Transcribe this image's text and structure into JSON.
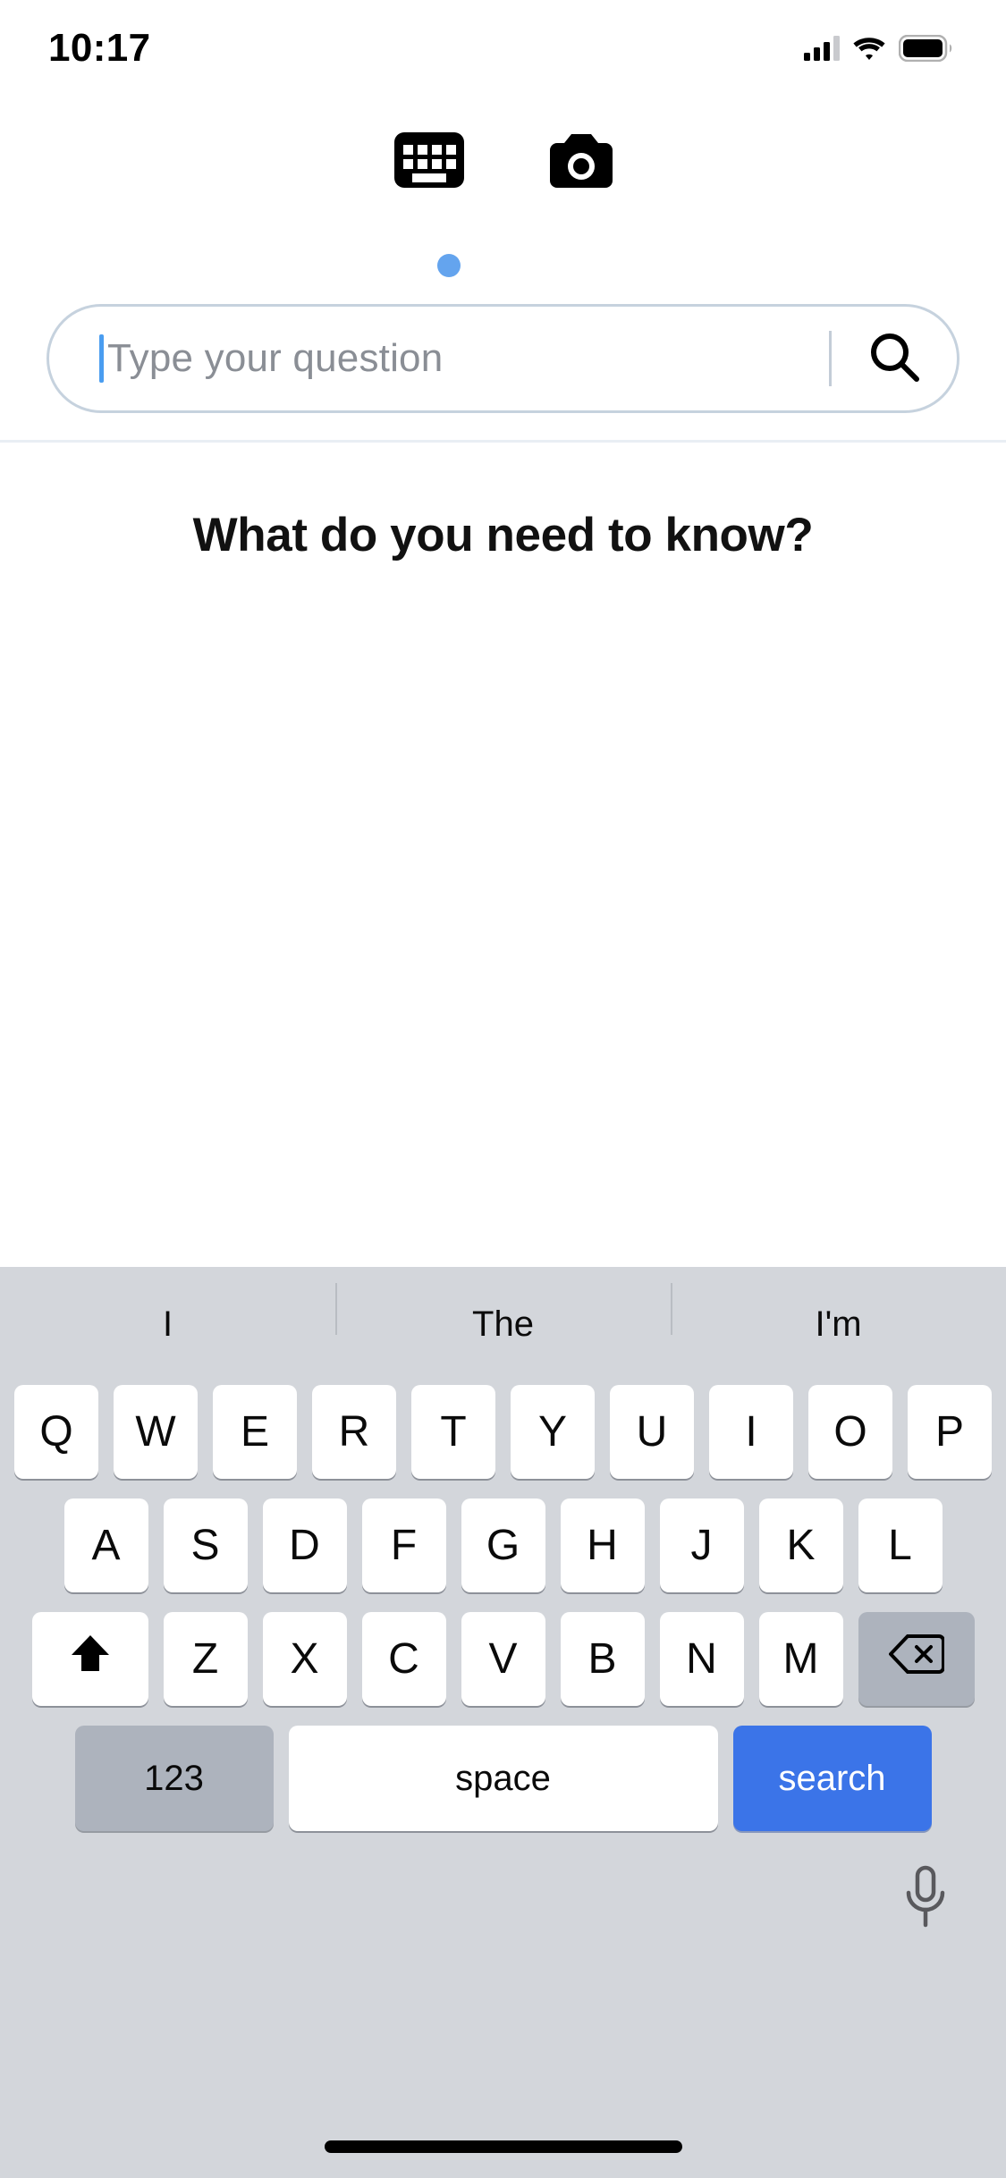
{
  "statusbar": {
    "time": "10:17",
    "signal_icon": "cellular-signal-icon",
    "wifi_icon": "wifi-icon",
    "battery_icon": "battery-full-icon"
  },
  "input_modes": {
    "keyboard_icon": "keyboard-icon",
    "camera_icon": "camera-icon",
    "active_indicator": "active-mode-dot",
    "active": "keyboard"
  },
  "search": {
    "placeholder": "Type your question",
    "value": "",
    "submit_icon": "search-icon"
  },
  "main": {
    "heading": "What do you need to know?"
  },
  "keyboard": {
    "suggestions": [
      "I",
      "The",
      "I'm"
    ],
    "row1": [
      "Q",
      "W",
      "E",
      "R",
      "T",
      "Y",
      "U",
      "I",
      "O",
      "P"
    ],
    "row2": [
      "A",
      "S",
      "D",
      "F",
      "G",
      "H",
      "J",
      "K",
      "L"
    ],
    "row3": [
      "Z",
      "X",
      "C",
      "V",
      "B",
      "N",
      "M"
    ],
    "shift_icon": "shift-arrow-icon",
    "backspace_icon": "backspace-icon",
    "numbers_label": "123",
    "space_label": "space",
    "return_label": "search",
    "dictation_icon": "microphone-icon"
  },
  "colors": {
    "accent_blue": "#3b74e8",
    "dot_blue": "#64a4ee",
    "caret_blue": "#4a9df0",
    "keyboard_bg": "#d3d6db",
    "key_bg": "#ffffff",
    "special_key_bg": "#adb3bd",
    "search_border": "#c6d2de"
  },
  "home_indicator": "home-indicator"
}
